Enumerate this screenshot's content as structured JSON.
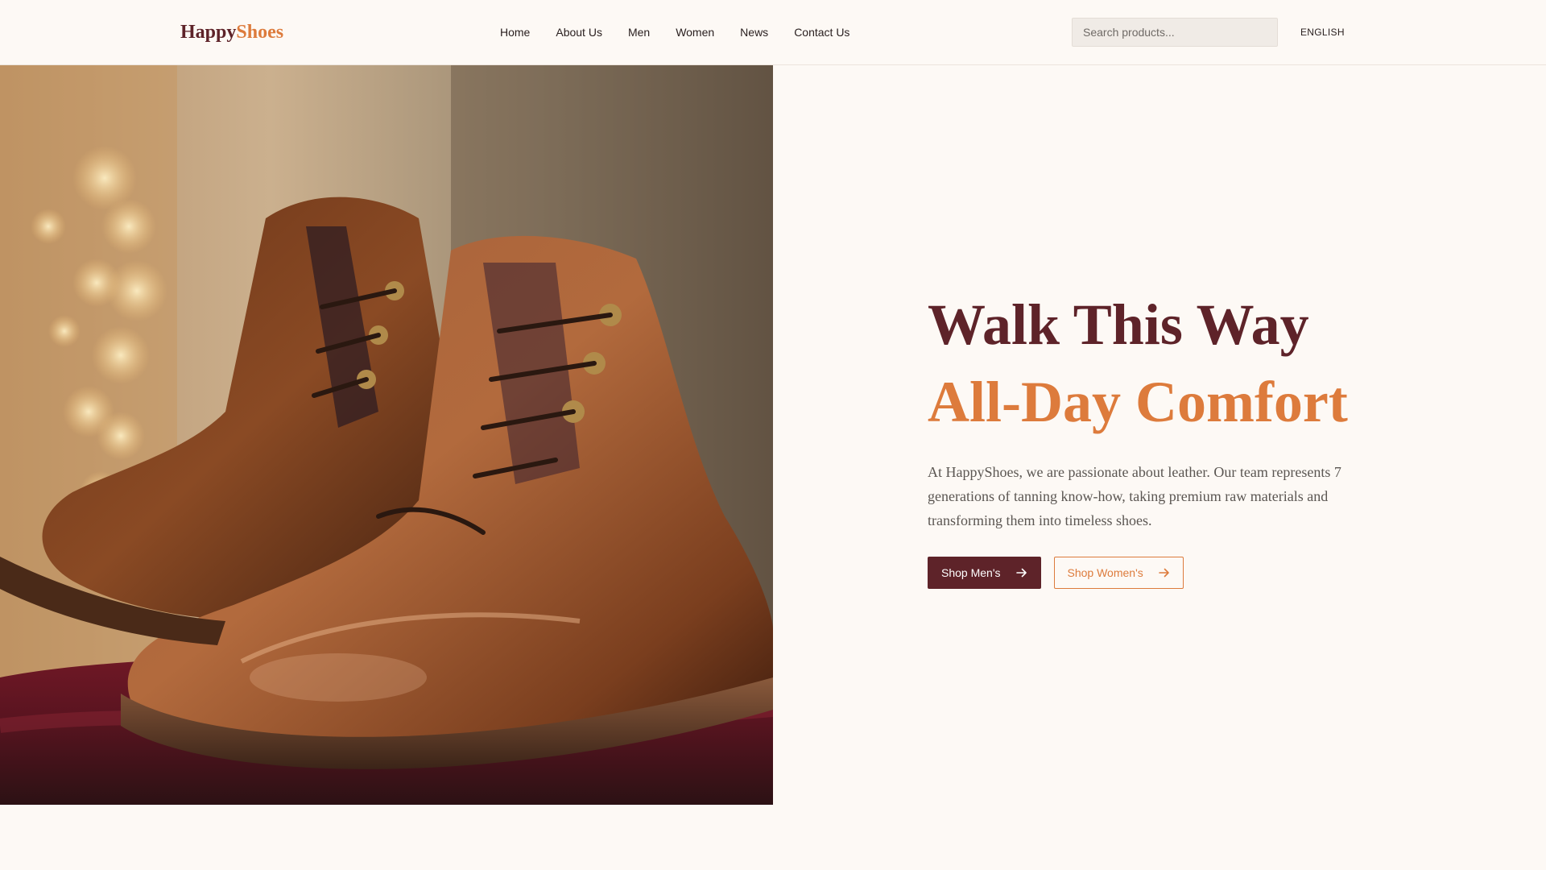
{
  "brand": {
    "part1": "Happy",
    "part2": "Shoes",
    "color1": "#5e2329",
    "color2": "#dd7b3c"
  },
  "nav": {
    "items": [
      {
        "label": "Home"
      },
      {
        "label": "About Us"
      },
      {
        "label": "Men"
      },
      {
        "label": "Women"
      },
      {
        "label": "News"
      },
      {
        "label": "Contact Us"
      }
    ]
  },
  "search": {
    "placeholder": "Search products...",
    "value": ""
  },
  "language": {
    "label": "ENGLISH"
  },
  "hero": {
    "image_subject": "brown leather lace-up boots on red velvet",
    "title": "Walk This Way",
    "subtitle": "All-Day Comfort",
    "description": "At HappyShoes, we are passionate about leather. Our team represents 7 generations of tanning know-how, taking premium raw materials and transforming them into timeless shoes.",
    "buttons": {
      "primary": {
        "label": "Shop Men's",
        "icon": "arrow-right-icon"
      },
      "secondary": {
        "label": "Shop Women's",
        "icon": "arrow-right-icon"
      }
    }
  },
  "colors": {
    "background": "#fdf9f5",
    "accent": "#dd7b3c",
    "brand": "#5e2329"
  }
}
